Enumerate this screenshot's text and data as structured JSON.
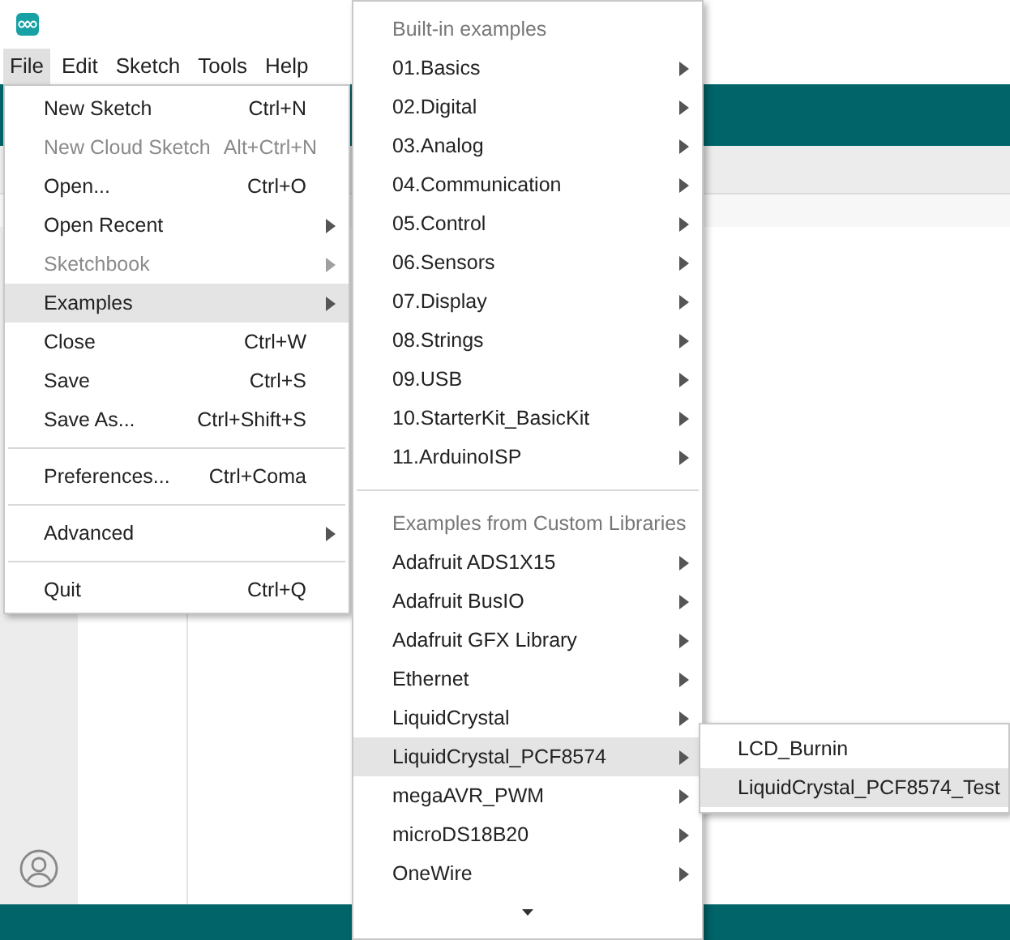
{
  "menubar": [
    {
      "label": "File",
      "selected": true
    },
    {
      "label": "Edit",
      "selected": false
    },
    {
      "label": "Sketch",
      "selected": false
    },
    {
      "label": "Tools",
      "selected": false
    },
    {
      "label": "Help",
      "selected": false
    }
  ],
  "file_menu": [
    {
      "kind": "item",
      "label": "New Sketch",
      "shortcut": "Ctrl+N",
      "submenu": false,
      "disabled": false,
      "selected": false
    },
    {
      "kind": "item",
      "label": "New Cloud Sketch",
      "shortcut": "Alt+Ctrl+N",
      "submenu": false,
      "disabled": true,
      "selected": false
    },
    {
      "kind": "item",
      "label": "Open...",
      "shortcut": "Ctrl+O",
      "submenu": false,
      "disabled": false,
      "selected": false
    },
    {
      "kind": "item",
      "label": "Open Recent",
      "submenu": true,
      "disabled": false,
      "selected": false
    },
    {
      "kind": "item",
      "label": "Sketchbook",
      "submenu": true,
      "disabled": true,
      "selected": false
    },
    {
      "kind": "item",
      "label": "Examples",
      "submenu": true,
      "disabled": false,
      "selected": true
    },
    {
      "kind": "item",
      "label": "Close",
      "shortcut": "Ctrl+W",
      "submenu": false,
      "disabled": false,
      "selected": false
    },
    {
      "kind": "item",
      "label": "Save",
      "shortcut": "Ctrl+S",
      "submenu": false,
      "disabled": false,
      "selected": false
    },
    {
      "kind": "item",
      "label": "Save As...",
      "shortcut": "Ctrl+Shift+S",
      "submenu": false,
      "disabled": false,
      "selected": false
    },
    {
      "kind": "separator"
    },
    {
      "kind": "item",
      "label": "Preferences...",
      "shortcut": "Ctrl+Coma",
      "submenu": false,
      "disabled": false,
      "selected": false
    },
    {
      "kind": "separator"
    },
    {
      "kind": "item",
      "label": "Advanced",
      "submenu": true,
      "disabled": false,
      "selected": false
    },
    {
      "kind": "separator"
    },
    {
      "kind": "item",
      "label": "Quit",
      "shortcut": "Ctrl+Q",
      "submenu": false,
      "disabled": false,
      "selected": false
    }
  ],
  "examples_menu": [
    {
      "kind": "header",
      "label": "Built-in examples"
    },
    {
      "kind": "item",
      "label": "01.Basics",
      "selected": false
    },
    {
      "kind": "item",
      "label": "02.Digital",
      "selected": false
    },
    {
      "kind": "item",
      "label": "03.Analog",
      "selected": false
    },
    {
      "kind": "item",
      "label": "04.Communication",
      "selected": false
    },
    {
      "kind": "item",
      "label": "05.Control",
      "selected": false
    },
    {
      "kind": "item",
      "label": "06.Sensors",
      "selected": false
    },
    {
      "kind": "item",
      "label": "07.Display",
      "selected": false
    },
    {
      "kind": "item",
      "label": "08.Strings",
      "selected": false
    },
    {
      "kind": "item",
      "label": "09.USB",
      "selected": false
    },
    {
      "kind": "item",
      "label": "10.StarterKit_BasicKit",
      "selected": false
    },
    {
      "kind": "item",
      "label": "11.ArduinoISP",
      "selected": false
    },
    {
      "kind": "separator"
    },
    {
      "kind": "header",
      "label": "Examples from Custom Libraries"
    },
    {
      "kind": "item",
      "label": "Adafruit ADS1X15",
      "selected": false
    },
    {
      "kind": "item",
      "label": "Adafruit BusIO",
      "selected": false
    },
    {
      "kind": "item",
      "label": "Adafruit GFX Library",
      "selected": false
    },
    {
      "kind": "item",
      "label": "Ethernet",
      "selected": false
    },
    {
      "kind": "item",
      "label": "LiquidCrystal",
      "selected": false
    },
    {
      "kind": "item",
      "label": "LiquidCrystal_PCF8574",
      "selected": true
    },
    {
      "kind": "item",
      "label": "megaAVR_PWM",
      "selected": false
    },
    {
      "kind": "item",
      "label": "microDS18B20",
      "selected": false
    },
    {
      "kind": "item",
      "label": "OneWire",
      "selected": false
    }
  ],
  "library_menu": [
    {
      "label": "LCD_Burnin",
      "selected": false
    },
    {
      "label": "LiquidCrystal_PCF8574_Test",
      "selected": true
    }
  ]
}
